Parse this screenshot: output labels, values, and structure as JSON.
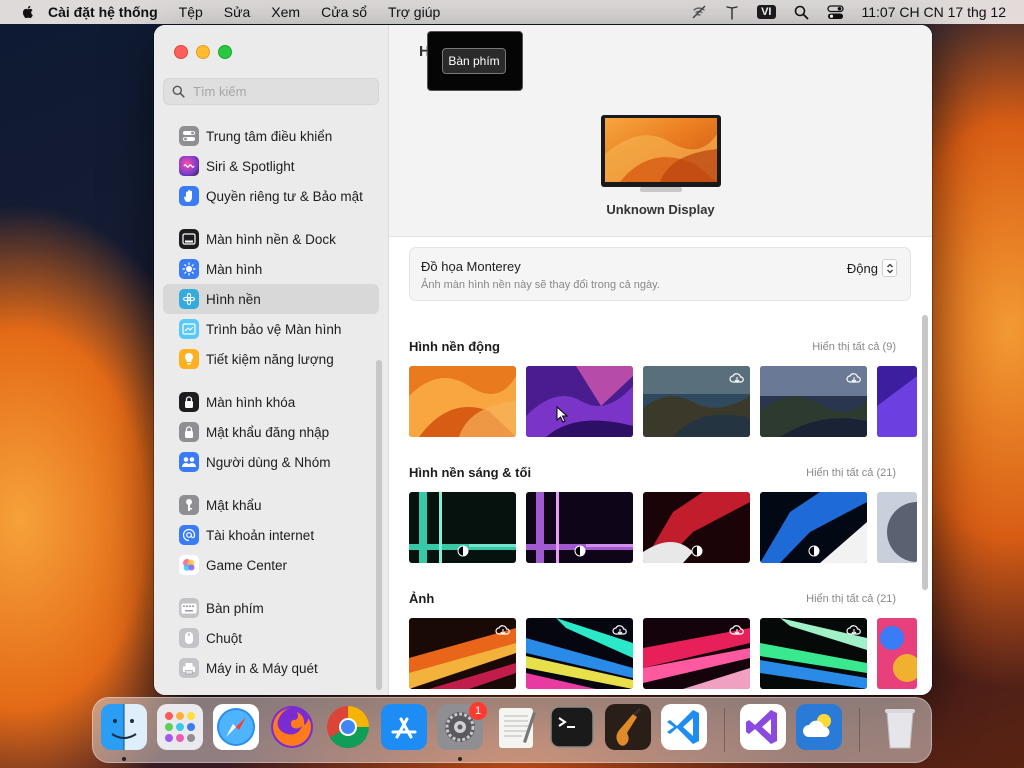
{
  "menubar": {
    "app_name": "Cài đặt hệ thống",
    "items": [
      "Tệp",
      "Sửa",
      "Xem",
      "Cửa sổ",
      "Trợ giúp"
    ],
    "input_source": "VI",
    "datetime": "11:07 CH CN 17 thg 12"
  },
  "sidebar": {
    "search_placeholder": "Tìm kiếm",
    "groups": [
      [
        {
          "label": "Trung tâm điều khiển",
          "icon": "control-center-icon",
          "color": "#8e8e93"
        },
        {
          "label": "Siri & Spotlight",
          "icon": "siri-icon",
          "color": "#7a3bd1"
        },
        {
          "label": "Quyền riêng tư & Bảo mật",
          "icon": "hand-icon",
          "color": "#3a7bf6"
        }
      ],
      [
        {
          "label": "Màn hình nền & Dock",
          "icon": "dock-icon",
          "color": "#1d1d1f"
        },
        {
          "label": "Màn hình",
          "icon": "brightness-icon",
          "color": "#3a7bf6"
        },
        {
          "label": "Hình nền",
          "icon": "wallpaper-icon",
          "color": "#36aadc",
          "selected": true
        },
        {
          "label": "Trình bảo vệ Màn hình",
          "icon": "screensaver-icon",
          "color": "#5ac8fa"
        },
        {
          "label": "Tiết kiệm năng lượng",
          "icon": "lightbulb-icon",
          "color": "#ffb020"
        }
      ],
      [
        {
          "label": "Màn hình khóa",
          "icon": "lock-icon",
          "color": "#1d1d1f"
        },
        {
          "label": "Mật khẩu đăng nhập",
          "icon": "lock-gray-icon",
          "color": "#8e8e93"
        },
        {
          "label": "Người dùng & Nhóm",
          "icon": "users-icon",
          "color": "#3a7bf6"
        }
      ],
      [
        {
          "label": "Mật khẩu",
          "icon": "key-icon",
          "color": "#8e8e93"
        },
        {
          "label": "Tài khoản internet",
          "icon": "at-icon",
          "color": "#3a7bf6"
        },
        {
          "label": "Game Center",
          "icon": "game-center-icon",
          "color": "#ffffff"
        }
      ],
      [
        {
          "label": "Bàn phím",
          "icon": "keyboard-icon",
          "color": "#b0b0b5"
        },
        {
          "label": "Chuột",
          "icon": "mouse-icon",
          "color": "#b0b0b5"
        },
        {
          "label": "Máy in & Máy quét",
          "icon": "printer-icon",
          "color": "#b0b0b5"
        }
      ]
    ]
  },
  "main": {
    "title_initial": "H",
    "tooltip": "Bàn phím",
    "display_name": "Unknown Display",
    "current": {
      "title": "Đồ họa Monterey",
      "subtitle": "Ảnh màn hình nền này sẽ thay đổi trong cả ngày.",
      "mode": "Động"
    },
    "sections": [
      {
        "title": "Hình nền động",
        "link": "Hiển thị tất cả (9)"
      },
      {
        "title": "Hình nền sáng & tối",
        "link": "Hiển thị tất cả (21)"
      },
      {
        "title": "Ảnh",
        "link": "Hiển thị tất cả (21)"
      }
    ]
  },
  "dock": {
    "apps": [
      "finder-icon",
      "launchpad-icon",
      "safari-icon",
      "firefox-icon",
      "chrome-icon",
      "app-store-icon",
      "system-settings-icon",
      "textedit-icon",
      "terminal-icon",
      "garageband-icon",
      "vscode-icon",
      "visual-studio-icon",
      "weather-icon",
      "trash-icon"
    ],
    "settings_badge": "1"
  }
}
